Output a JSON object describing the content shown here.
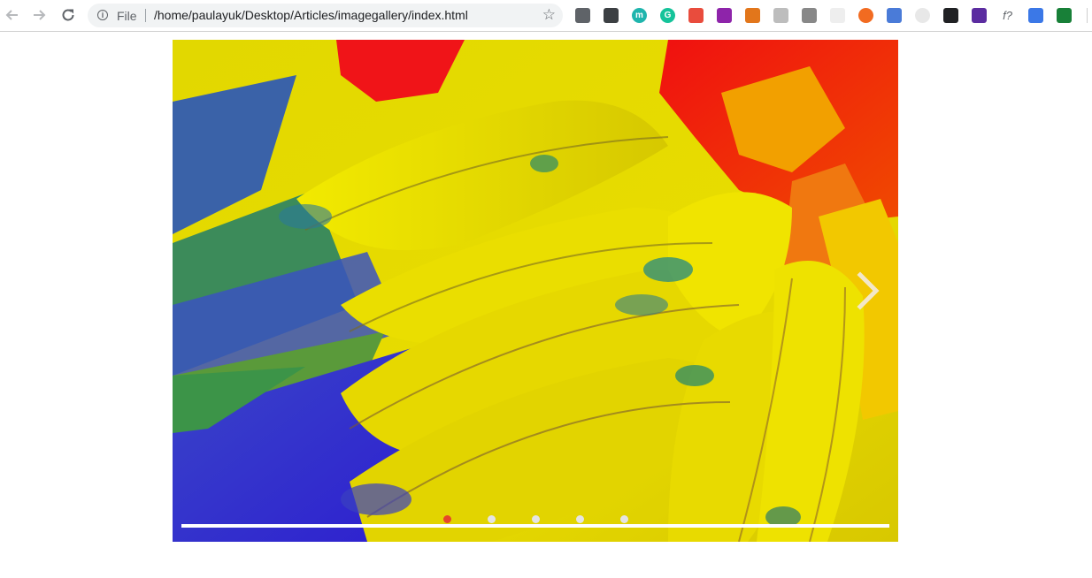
{
  "browser": {
    "file_label": "File",
    "url": "/home/paulayuk/Desktop/Articles/imagegallery/index.html",
    "icons": {
      "back": "arrow-left-icon",
      "forward": "arrow-right-icon",
      "reload": "reload-icon",
      "info": "info-icon",
      "bookmark": "star-icon"
    },
    "extensions": [
      {
        "name": "settings-gear-extension",
        "color": "#5f6368"
      },
      {
        "name": "pocket-extension",
        "color": "#3c4043"
      },
      {
        "name": "mercury-extension",
        "color": "#1fb5ad",
        "text": "m"
      },
      {
        "name": "grammarly-extension",
        "color": "#15c39a",
        "text": "G"
      },
      {
        "name": "colorpick-extension",
        "color": "#e94c3d"
      },
      {
        "name": "feather-extension",
        "color": "#8e24aa"
      },
      {
        "name": "metamask-extension",
        "color": "#e2761b"
      },
      {
        "name": "readability-extension",
        "color": "#bdbdbd"
      },
      {
        "name": "vue-devtools-extension",
        "color": "#888888"
      },
      {
        "name": "blank-extension",
        "color": "#eeeeee"
      },
      {
        "name": "orange-circle-extension",
        "color": "#f26b21"
      },
      {
        "name": "translate-extension",
        "color": "#4a7bd8"
      },
      {
        "name": "clock-extension",
        "color": "#e8e8e8"
      },
      {
        "name": "more-extension",
        "color": "#202124"
      },
      {
        "name": "purple-extension",
        "color": "#5b2ca0"
      },
      {
        "name": "fontface-extension",
        "color": "#ffffff",
        "text": "f?"
      },
      {
        "name": "download-extension",
        "color": "#3b78e7"
      },
      {
        "name": "green-extension",
        "color": "#188038"
      }
    ]
  },
  "gallery": {
    "slide_count": 5,
    "active_slide": 1,
    "accent_color": "#e6462a",
    "next_icon": "chevron-right-icon"
  }
}
